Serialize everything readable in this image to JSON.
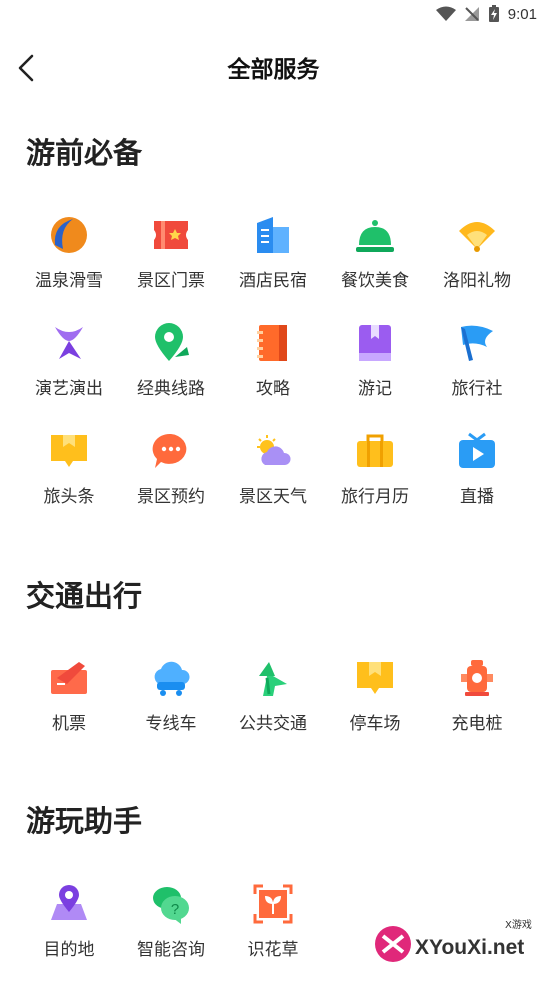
{
  "status": {
    "time": "9:01"
  },
  "header": {
    "title": "全部服务"
  },
  "sections": [
    {
      "title": "游前必备",
      "items": [
        {
          "label": "温泉滑雪",
          "icon": "hot-spring-ski-icon"
        },
        {
          "label": "景区门票",
          "icon": "ticket-icon"
        },
        {
          "label": "酒店民宿",
          "icon": "hotel-icon"
        },
        {
          "label": "餐饮美食",
          "icon": "dining-icon"
        },
        {
          "label": "洛阳礼物",
          "icon": "gift-fan-icon"
        },
        {
          "label": "演艺演出",
          "icon": "performance-icon"
        },
        {
          "label": "经典线路",
          "icon": "route-icon"
        },
        {
          "label": "攻略",
          "icon": "guide-book-icon"
        },
        {
          "label": "游记",
          "icon": "travel-notes-icon"
        },
        {
          "label": "旅行社",
          "icon": "travel-agency-flag-icon"
        },
        {
          "label": "旅头条",
          "icon": "headline-icon"
        },
        {
          "label": "景区预约",
          "icon": "reservation-chat-icon"
        },
        {
          "label": "景区天气",
          "icon": "weather-icon"
        },
        {
          "label": "旅行月历",
          "icon": "calendar-bag-icon"
        },
        {
          "label": "直播",
          "icon": "live-tv-icon"
        }
      ]
    },
    {
      "title": "交通出行",
      "items": [
        {
          "label": "机票",
          "icon": "airplane-ticket-icon"
        },
        {
          "label": "专线车",
          "icon": "shuttle-bus-icon"
        },
        {
          "label": "公共交通",
          "icon": "public-transit-icon"
        },
        {
          "label": "停车场",
          "icon": "parking-icon"
        },
        {
          "label": "充电桩",
          "icon": "charging-pile-icon"
        }
      ]
    },
    {
      "title": "游玩助手",
      "items": [
        {
          "label": "目的地",
          "icon": "destination-icon"
        },
        {
          "label": "智能咨询",
          "icon": "smart-consult-icon"
        },
        {
          "label": "识花草",
          "icon": "plant-recognition-icon"
        }
      ]
    }
  ],
  "watermark": {
    "text": "XYouXi.net",
    "sub": "X游戏"
  }
}
